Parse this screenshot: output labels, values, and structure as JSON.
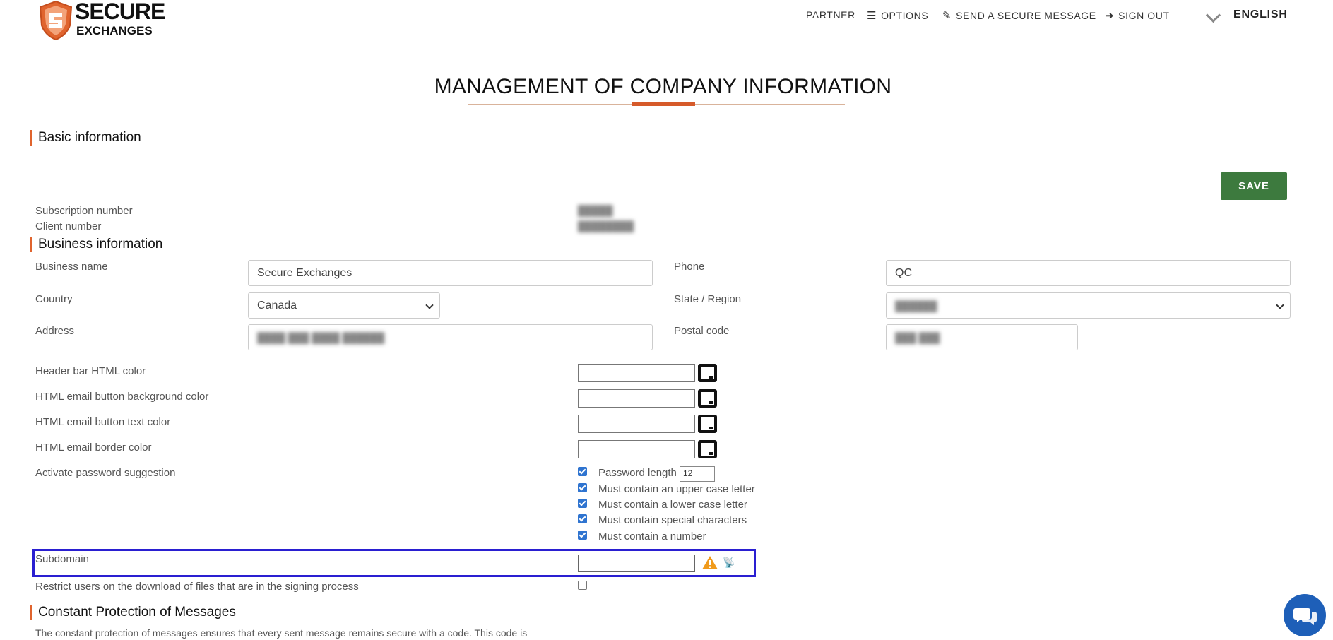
{
  "header": {
    "logo_line1": "SECURE",
    "logo_line2": "EXCHANGES",
    "nav": [
      {
        "label": "PARTNER",
        "icon": ""
      },
      {
        "label": "OPTIONS",
        "icon": "menu-icon"
      },
      {
        "label": "SEND A SECURE MESSAGE",
        "icon": "edit-icon"
      },
      {
        "label": "SIGN OUT",
        "icon": "sign-out-icon"
      }
    ],
    "language": "ENGLISH"
  },
  "page_title": "MANAGEMENT OF COMPANY INFORMATION",
  "save_label": "SAVE",
  "basic": {
    "heading": "Basic information",
    "subscription_label": "Subscription number",
    "client_label": "Client number"
  },
  "business": {
    "heading": "Business information",
    "name_label": "Business name",
    "name_value": "Secure Exchanges",
    "phone_label": "Phone",
    "phone_value": "QC",
    "country_label": "Country",
    "country_value": "Canada",
    "state_label": "State / Region",
    "address_label": "Address",
    "postal_label": "Postal code"
  },
  "colors": {
    "header_bar": "Header bar HTML color",
    "button_bg": "HTML email button background color",
    "button_text": "HTML email button text color",
    "border": "HTML email border color"
  },
  "password": {
    "label": "Activate password suggestion",
    "length_label": "Password length",
    "length_value": "12",
    "upper": "Must contain an upper case letter",
    "lower": "Must contain a lower case letter",
    "special": "Must contain special characters",
    "number": "Must contain a number"
  },
  "subdomain": {
    "label": "Subdomain"
  },
  "restrict_label": "Restrict users on the download of files that are in the signing process",
  "protection": {
    "heading": "Constant Protection of Messages",
    "description": "The constant protection of messages ensures that every sent message remains secure with a code. This code is"
  },
  "theme": {
    "accent": "#e0642e",
    "save_green": "#3d7a3e",
    "checkbox_blue": "#2f74d0",
    "highlight": "#2a1fd1",
    "chat_blue": "#1e5fb8"
  }
}
